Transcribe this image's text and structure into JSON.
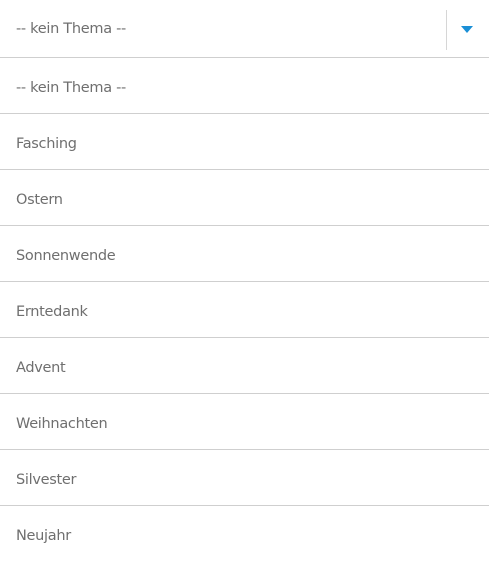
{
  "select": {
    "selected_value": "-- kein Thema --",
    "caret_icon": "chevron-down-icon",
    "accent_color": "#1a8fd6"
  },
  "options": [
    "-- kein Thema --",
    "Fasching",
    "Ostern",
    "Sonnenwende",
    "Erntedank",
    "Advent",
    "Weihnachten",
    "Silvester",
    "Neujahr"
  ]
}
